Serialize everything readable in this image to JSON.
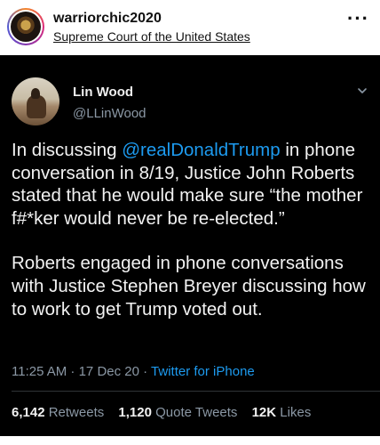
{
  "post": {
    "username": "warriorchic2020",
    "location": "Supreme Court of the United States",
    "more_icon": "more-horizontal-icon"
  },
  "tweet": {
    "display_name": "Lin Wood",
    "handle": "@LLinWood",
    "chevron_icon": "chevron-down-icon",
    "para1_prefix": "In discussing ",
    "mention": "@realDonaldTrump",
    "para1_suffix": " in phone conversation in 8/19, Justice John Roberts stated that he would make sure “the mother f#*ker would never be re-elected.”",
    "para2": "Roberts engaged in phone conversations with Justice Stephen Breyer discussing how to work to get Trump voted out.",
    "timestamp": "11:25 AM · 17 Dec 20 · ",
    "source": "Twitter for iPhone",
    "stats": [
      {
        "value": "6,142",
        "label": "Retweets"
      },
      {
        "value": "1,120",
        "label": "Quote Tweets"
      },
      {
        "value": "12K",
        "label": "Likes"
      }
    ],
    "mention_color": "#1d9bf0",
    "background_color": "#000000"
  }
}
